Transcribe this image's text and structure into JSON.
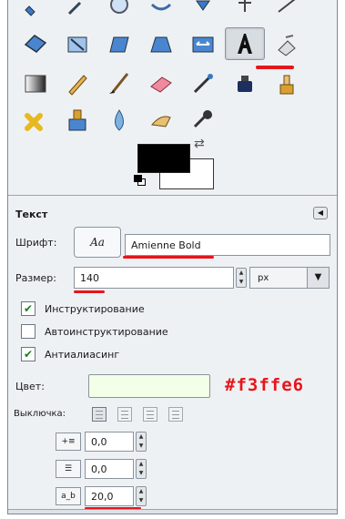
{
  "toolbox": {
    "rows": [
      [
        "move-tool",
        "crop-tool",
        "zoom-tool",
        "warp-tool",
        "align-tool",
        "transform-tool",
        "measure-tool"
      ],
      [
        "rotate-tool",
        "scale-tool",
        "shear-tool",
        "perspective-tool",
        "flip-tool",
        "text-tool",
        "fuzzy-select-tool"
      ],
      [
        "blend-tool",
        "pencil-tool",
        "paintbrush-tool",
        "eraser-tool",
        "airbrush-tool",
        "ink-tool",
        "clone-tool"
      ],
      [
        "heal-tool",
        "perspective-clone-tool",
        "blur-tool",
        "smudge-tool",
        "dodge-burn-tool"
      ]
    ],
    "active_tool": "text-tool",
    "foreground_color": "#000000",
    "background_color": "#ffffff"
  },
  "options": {
    "title": "Текст",
    "font_label": "Шрифт:",
    "font_preview": "Aa",
    "font_value": "Amienne Bold",
    "size_label": "Размер:",
    "size_value": "140",
    "unit": "px",
    "hinting_label": "Инструктирование",
    "hinting_checked": true,
    "autohint_label": "Автоинструктирование",
    "autohint_checked": false,
    "antialias_label": "Антиалиасинг",
    "antialias_checked": true,
    "color_label": "Цвет:",
    "color_value": "#f3ffe6",
    "color_annotation": "#f3ffe6",
    "justify_label": "Выключка:",
    "indent_value": "0,0",
    "line_spacing_value": "0,0",
    "letter_spacing_value": "20,0",
    "check_mark": "✔",
    "spin_up": "▲",
    "spin_down": "▼",
    "dropdown_arrow": "▼",
    "panel_menu_icon": "◀",
    "swap_icon": "⇄",
    "indent_icon": "+≡",
    "line_spacing_icon": "☰",
    "letter_spacing_icon": "a_b"
  },
  "annotation_color": "#e8141a"
}
